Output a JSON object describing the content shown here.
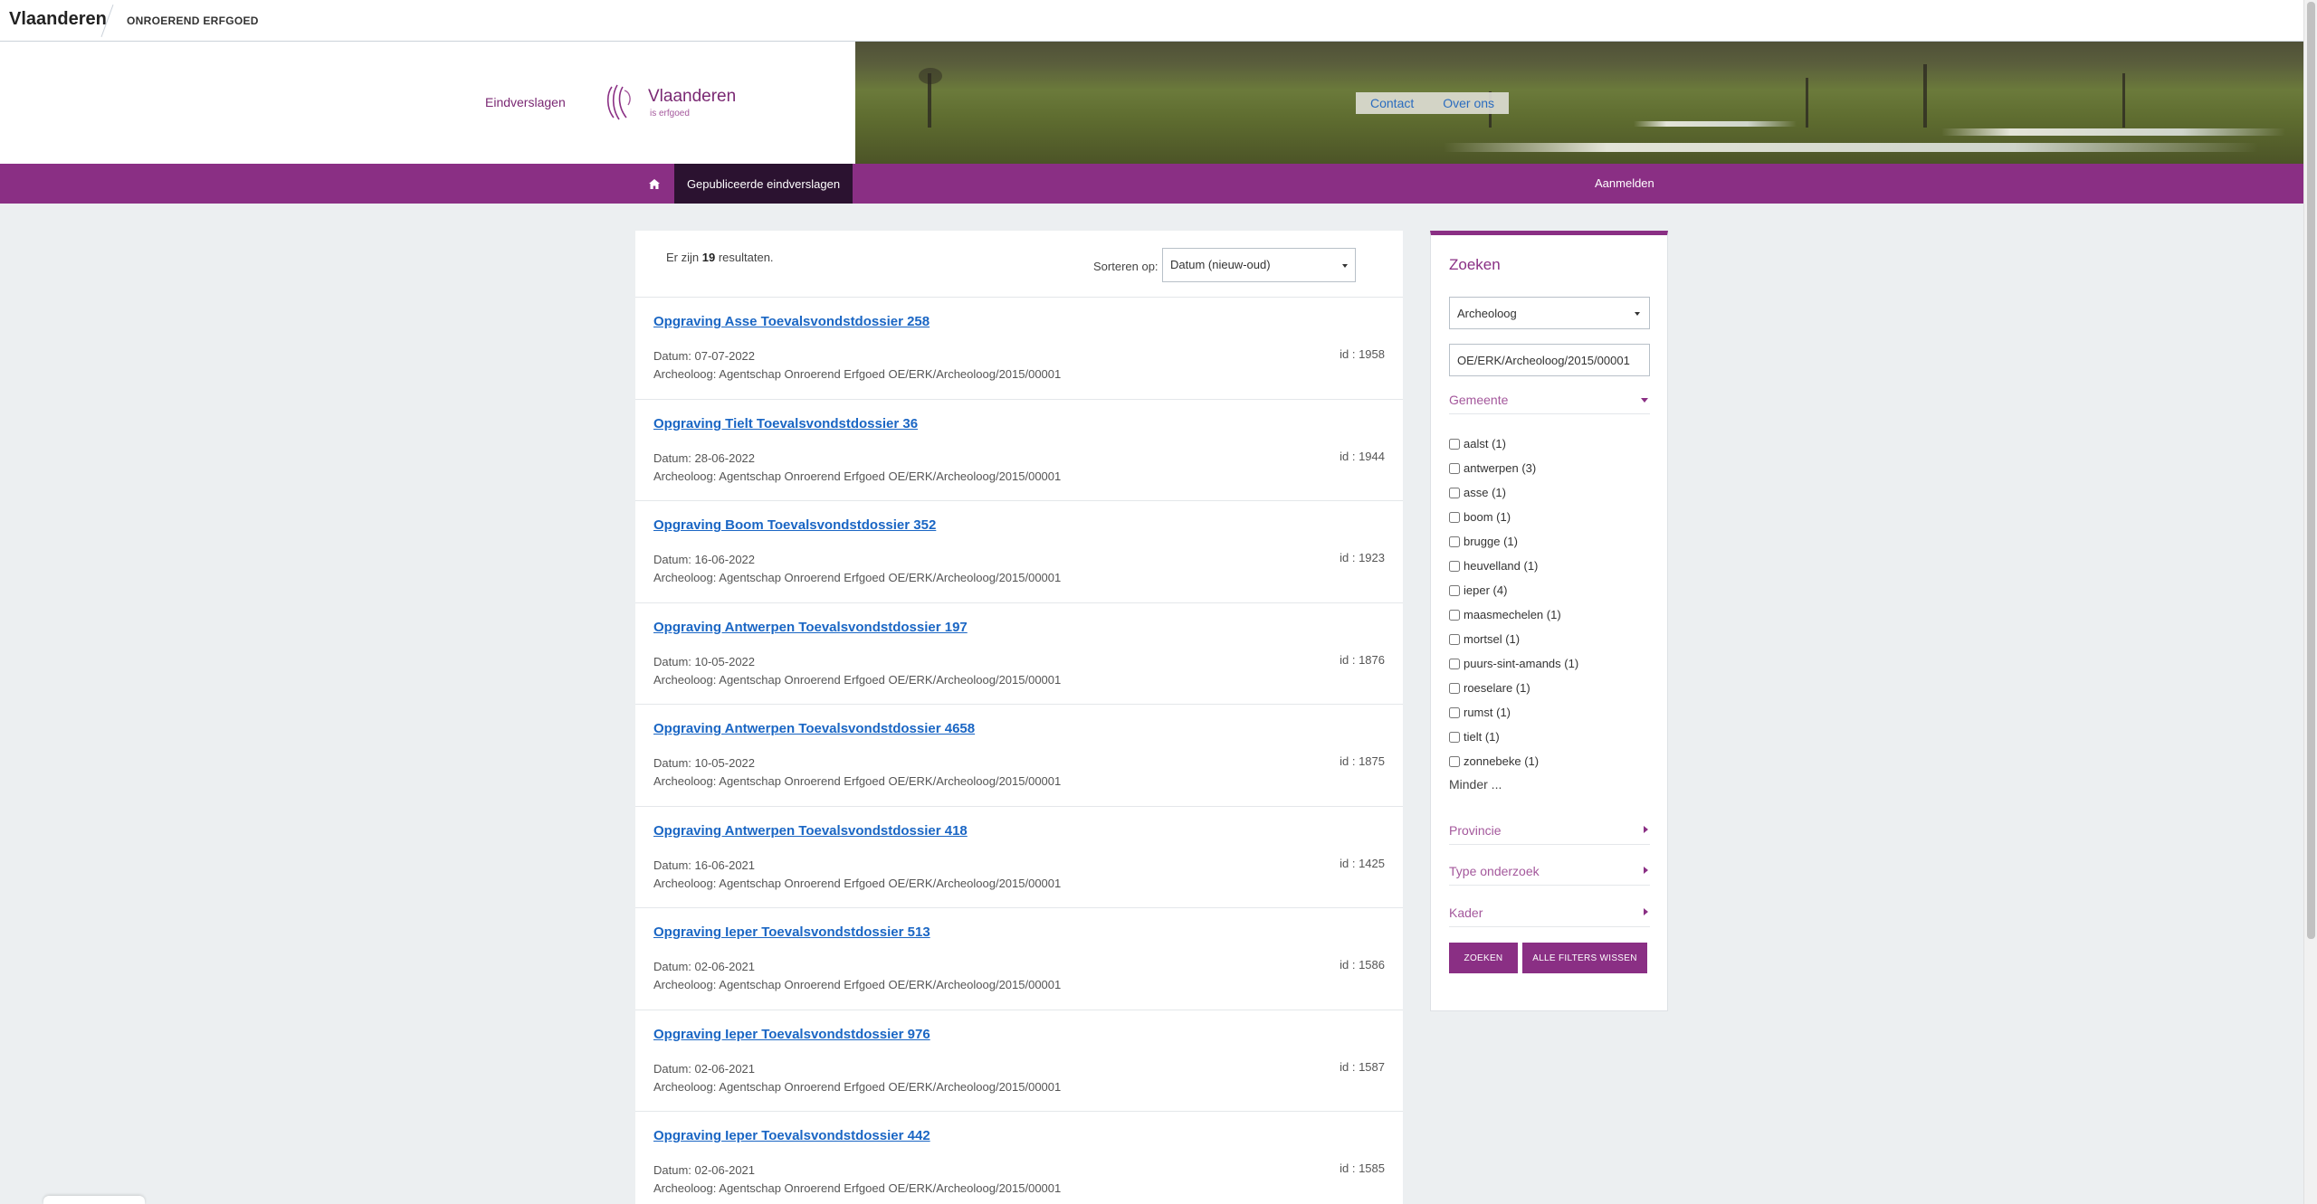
{
  "global_header": {
    "brand": "Vlaanderen",
    "entity": "ONROEREND ERFGOED"
  },
  "site": {
    "title": "Eindverslagen",
    "logo_word": "Vlaanderen",
    "logo_sub": "is erfgoed"
  },
  "service_nav": {
    "contact": "Contact",
    "about": "Over ons"
  },
  "main_nav": {
    "home_icon": "home-icon",
    "active_label": "Gepubliceerde eindverslagen",
    "login": "Aanmelden"
  },
  "results": {
    "count_prefix": "Er zijn",
    "count": "19",
    "count_suffix": "resultaten.",
    "sort_label": "Sorteren op:",
    "sort_value": "Datum (nieuw-oud)",
    "items": [
      {
        "title": "Opgraving Asse Toevalsvondstdossier 258",
        "date": "Datum: 07-07-2022",
        "arch": "Archeoloog: Agentschap Onroerend Erfgoed OE/ERK/Archeoloog/2015/00001",
        "id": "id : 1958"
      },
      {
        "title": "Opgraving Tielt Toevalsvondstdossier 36",
        "date": "Datum: 28-06-2022",
        "arch": "Archeoloog: Agentschap Onroerend Erfgoed OE/ERK/Archeoloog/2015/00001",
        "id": "id : 1944"
      },
      {
        "title": "Opgraving Boom Toevalsvondstdossier 352",
        "date": "Datum: 16-06-2022",
        "arch": "Archeoloog: Agentschap Onroerend Erfgoed OE/ERK/Archeoloog/2015/00001",
        "id": "id : 1923"
      },
      {
        "title": "Opgraving Antwerpen Toevalsvondstdossier 197",
        "date": "Datum: 10-05-2022",
        "arch": "Archeoloog: Agentschap Onroerend Erfgoed OE/ERK/Archeoloog/2015/00001",
        "id": "id : 1876"
      },
      {
        "title": "Opgraving Antwerpen Toevalsvondstdossier 4658",
        "date": "Datum: 10-05-2022",
        "arch": "Archeoloog: Agentschap Onroerend Erfgoed OE/ERK/Archeoloog/2015/00001",
        "id": "id : 1875"
      },
      {
        "title": "Opgraving Antwerpen Toevalsvondstdossier 418",
        "date": "Datum: 16-06-2021",
        "arch": "Archeoloog: Agentschap Onroerend Erfgoed OE/ERK/Archeoloog/2015/00001",
        "id": "id : 1425"
      },
      {
        "title": "Opgraving Ieper Toevalsvondstdossier 513",
        "date": "Datum: 02-06-2021",
        "arch": "Archeoloog: Agentschap Onroerend Erfgoed OE/ERK/Archeoloog/2015/00001",
        "id": "id : 1586"
      },
      {
        "title": "Opgraving Ieper Toevalsvondstdossier 976",
        "date": "Datum: 02-06-2021",
        "arch": "Archeoloog: Agentschap Onroerend Erfgoed OE/ERK/Archeoloog/2015/00001",
        "id": "id : 1587"
      },
      {
        "title": "Opgraving Ieper Toevalsvondstdossier 442",
        "date": "Datum: 02-06-2021",
        "arch": "Archeoloog: Agentschap Onroerend Erfgoed OE/ERK/Archeoloog/2015/00001",
        "id": "id : 1585"
      }
    ]
  },
  "sidebar": {
    "title": "Zoeken",
    "select_value": "Archeoloog",
    "input_value": "OE/ERK/Archeoloog/2015/00001",
    "facets": {
      "gemeente": "Gemeente",
      "provincie": "Provincie",
      "type_onderzoek": "Type onderzoek",
      "kader": "Kader"
    },
    "gemeente_options": [
      "aalst (1)",
      "antwerpen (3)",
      "asse (1)",
      "boom (1)",
      "brugge (1)",
      "heuvelland (1)",
      "ieper (4)",
      "maasmechelen (1)",
      "mortsel (1)",
      "puurs-sint-amands (1)",
      "roeselare (1)",
      "rumst (1)",
      "tielt (1)",
      "zonnebeke (1)"
    ],
    "minder": "Minder ...",
    "search_button": "ZOEKEN",
    "clear_button": "ALLE FILTERS WISSEN"
  },
  "colors": {
    "accent": "#8a2f84",
    "link": "#1a66c4",
    "nav_active": "#2b1230"
  }
}
